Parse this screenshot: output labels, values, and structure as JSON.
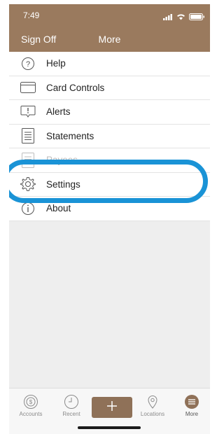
{
  "status": {
    "time": "7:49"
  },
  "nav": {
    "left_label": "Sign Off",
    "title": "More"
  },
  "menu": {
    "items": [
      {
        "label": "Help",
        "icon": "help-icon"
      },
      {
        "label": "Card Controls",
        "icon": "card-icon"
      },
      {
        "label": "Alerts",
        "icon": "alert-icon"
      },
      {
        "label": "Statements",
        "icon": "document-icon"
      },
      {
        "label": "Payees",
        "icon": "payees-icon"
      },
      {
        "label": "Settings",
        "icon": "gear-icon"
      },
      {
        "label": "About",
        "icon": "info-icon"
      }
    ]
  },
  "tabs": [
    {
      "label": "Accounts",
      "icon": "accounts-icon"
    },
    {
      "label": "Recent",
      "icon": "clock-icon"
    },
    {
      "label": "Locations",
      "icon": "location-icon"
    },
    {
      "label": "More",
      "icon": "menu-icon"
    }
  ],
  "colors": {
    "brand": "#9a7a5e",
    "highlight": "#1a93d6",
    "add_button": "#8f7158"
  }
}
